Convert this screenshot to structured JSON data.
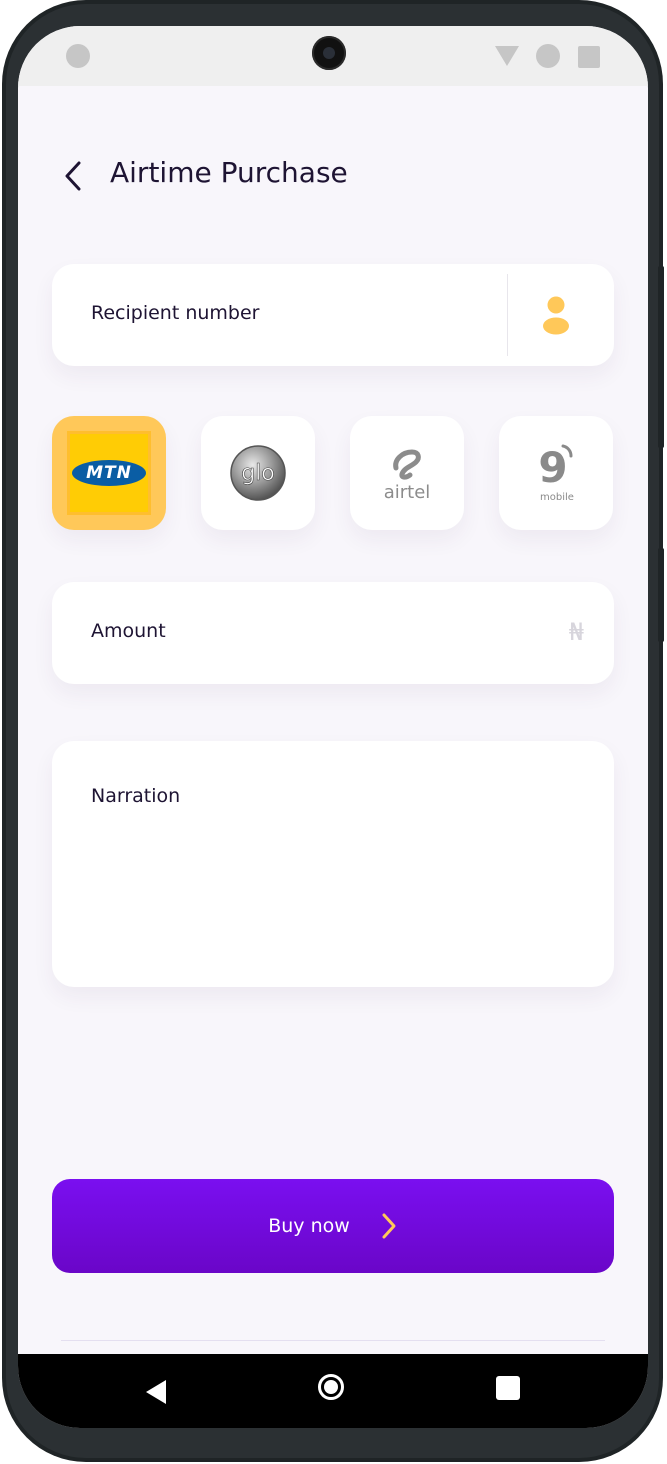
{
  "header": {
    "title": "Airtime Purchase"
  },
  "recipient": {
    "label": "Recipient number",
    "contact_icon": "person-icon"
  },
  "networks": [
    {
      "name": "mtn",
      "logo_text": "MTN",
      "selected": true
    },
    {
      "name": "glo",
      "logo_text": "glo",
      "selected": false
    },
    {
      "name": "airtel",
      "logo_text": "airtel",
      "selected": false
    },
    {
      "name": "9mobile",
      "logo_text": "9",
      "logo_subtext": "mobile",
      "selected": false
    }
  ],
  "amount": {
    "label": "Amount",
    "currency_symbol": "₦"
  },
  "narration": {
    "label": "Narration"
  },
  "buy_button": {
    "label": "Buy now"
  },
  "colors": {
    "accent": "#7a0ff0",
    "selected_network": "#ffc859",
    "contact_icon": "#ffc859",
    "arrow": "#ffc859",
    "background": "#f8f6fb"
  }
}
